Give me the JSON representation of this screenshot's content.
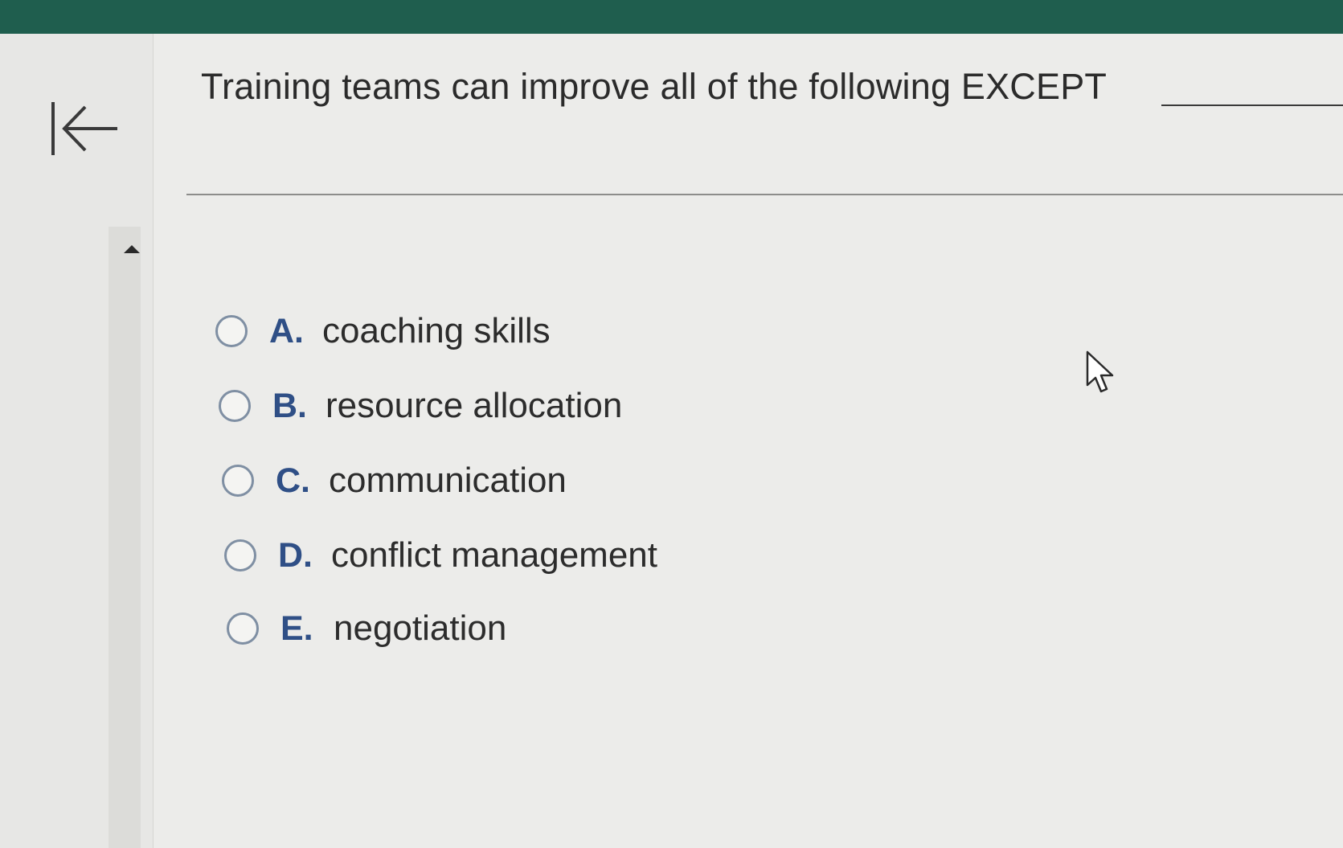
{
  "question": {
    "text": "Training teams can improve all of the following EXCEPT"
  },
  "options": [
    {
      "letter": "A.",
      "text": "coaching skills"
    },
    {
      "letter": "B.",
      "text": "resource allocation"
    },
    {
      "letter": "C.",
      "text": "communication"
    },
    {
      "letter": "D.",
      "text": "conflict management"
    },
    {
      "letter": "E.",
      "text": "negotiation"
    }
  ],
  "colors": {
    "top_bar": "#1f5e4e",
    "option_letter": "#2f4f86",
    "radio_border": "#7f8fa3"
  },
  "icons": {
    "back": "first-page-arrow-icon",
    "scroll": "scroll-up-arrow-icon",
    "cursor": "mouse-pointer-icon"
  }
}
